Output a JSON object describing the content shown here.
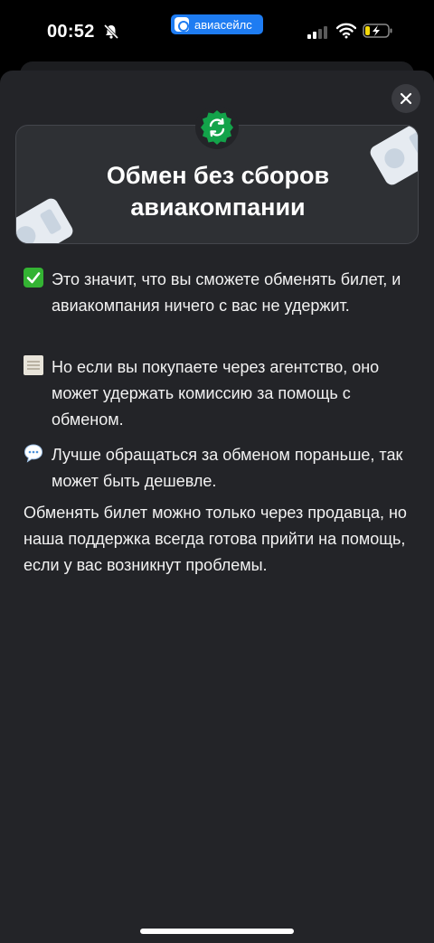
{
  "status_bar": {
    "time": "00:52",
    "app_name": "авиасейлс",
    "accent_color": "#1e7cf2"
  },
  "banner": {
    "title": "Обмен без сборов авиакомпании",
    "badge_icon": "exchange-arrows-icon",
    "badge_color": "#13a34a"
  },
  "items": [
    {
      "icon": "check-mark-icon",
      "text": "Это значит, что вы сможете обменять билет, и авиакомпания ничего с вас не удержит."
    },
    {
      "icon": "scroll-icon",
      "text": "Но если вы покупаете через агентство, оно может удержать комиссию за помощь с обменом."
    },
    {
      "icon": "speech-bubble-icon",
      "text": "Лучше обращаться за обменом пораньше, так может быть дешевле."
    }
  ],
  "footer_text": "Обменять билет можно только через продавца, но наша поддержка всегда готова прийти на помощь, если у вас возникнут проблемы."
}
